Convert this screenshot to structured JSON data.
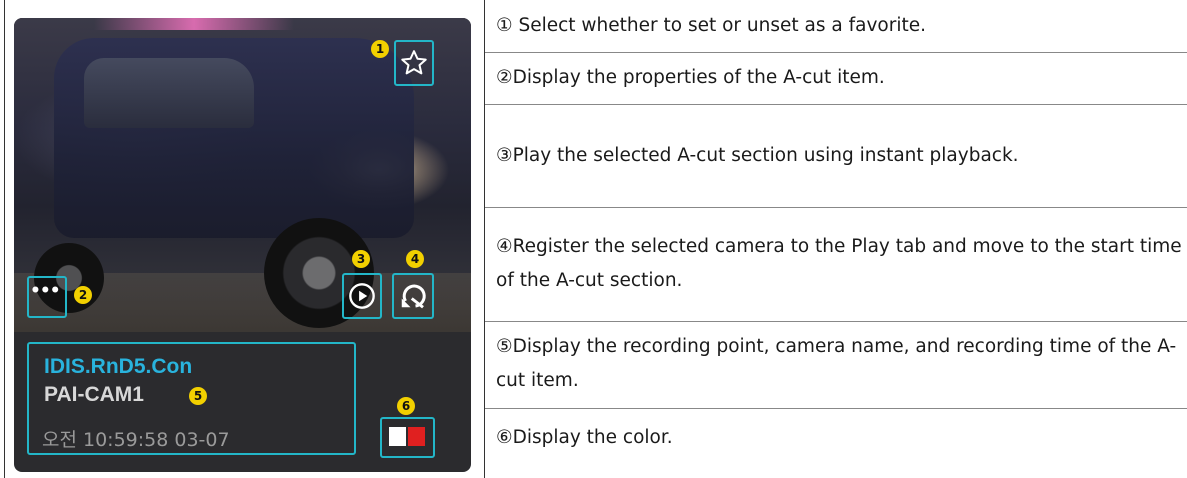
{
  "panel": {
    "dots_glyph": "•••",
    "site_name": "IDIS.RnD5.Con",
    "camera_name": "PAI-CAM1",
    "recording_time": "오전 10:59:58 03-07",
    "callouts": [
      "1",
      "2",
      "3",
      "4",
      "5",
      "6"
    ],
    "icons": [
      "star-icon",
      "more-dots-icon",
      "play-icon",
      "go-to-play-tab-icon"
    ],
    "colors": {
      "highlight": "#23b6c8",
      "callout": "#f2d000",
      "site": "#29b3dd",
      "swatch_white": "#ffffff",
      "swatch_red": "#e02020"
    }
  },
  "descriptions": [
    "① Select whether to set or unset as a favorite.",
    "②Display the properties of the A-cut item.",
    "③Play the selected A-cut section using instant playback.",
    "④Register the selected camera to the Play tab and move to the start time of the A-cut section.",
    "⑤Display the recording point, camera name, and recording time of the A-cut item.",
    "⑥Display the color."
  ]
}
